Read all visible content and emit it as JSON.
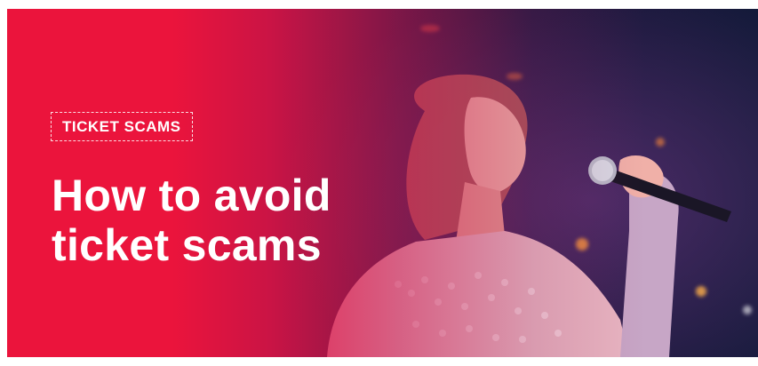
{
  "banner": {
    "tag_label": "TICKET SCAMS",
    "headline_line1": "How to avoid",
    "headline_line2": "ticket scams"
  },
  "colors": {
    "brand_red": "#eb143c",
    "headline_text": "#ffffff"
  },
  "image": {
    "subject": "performer-singing-photo",
    "icons": [
      "microphone-icon"
    ]
  }
}
